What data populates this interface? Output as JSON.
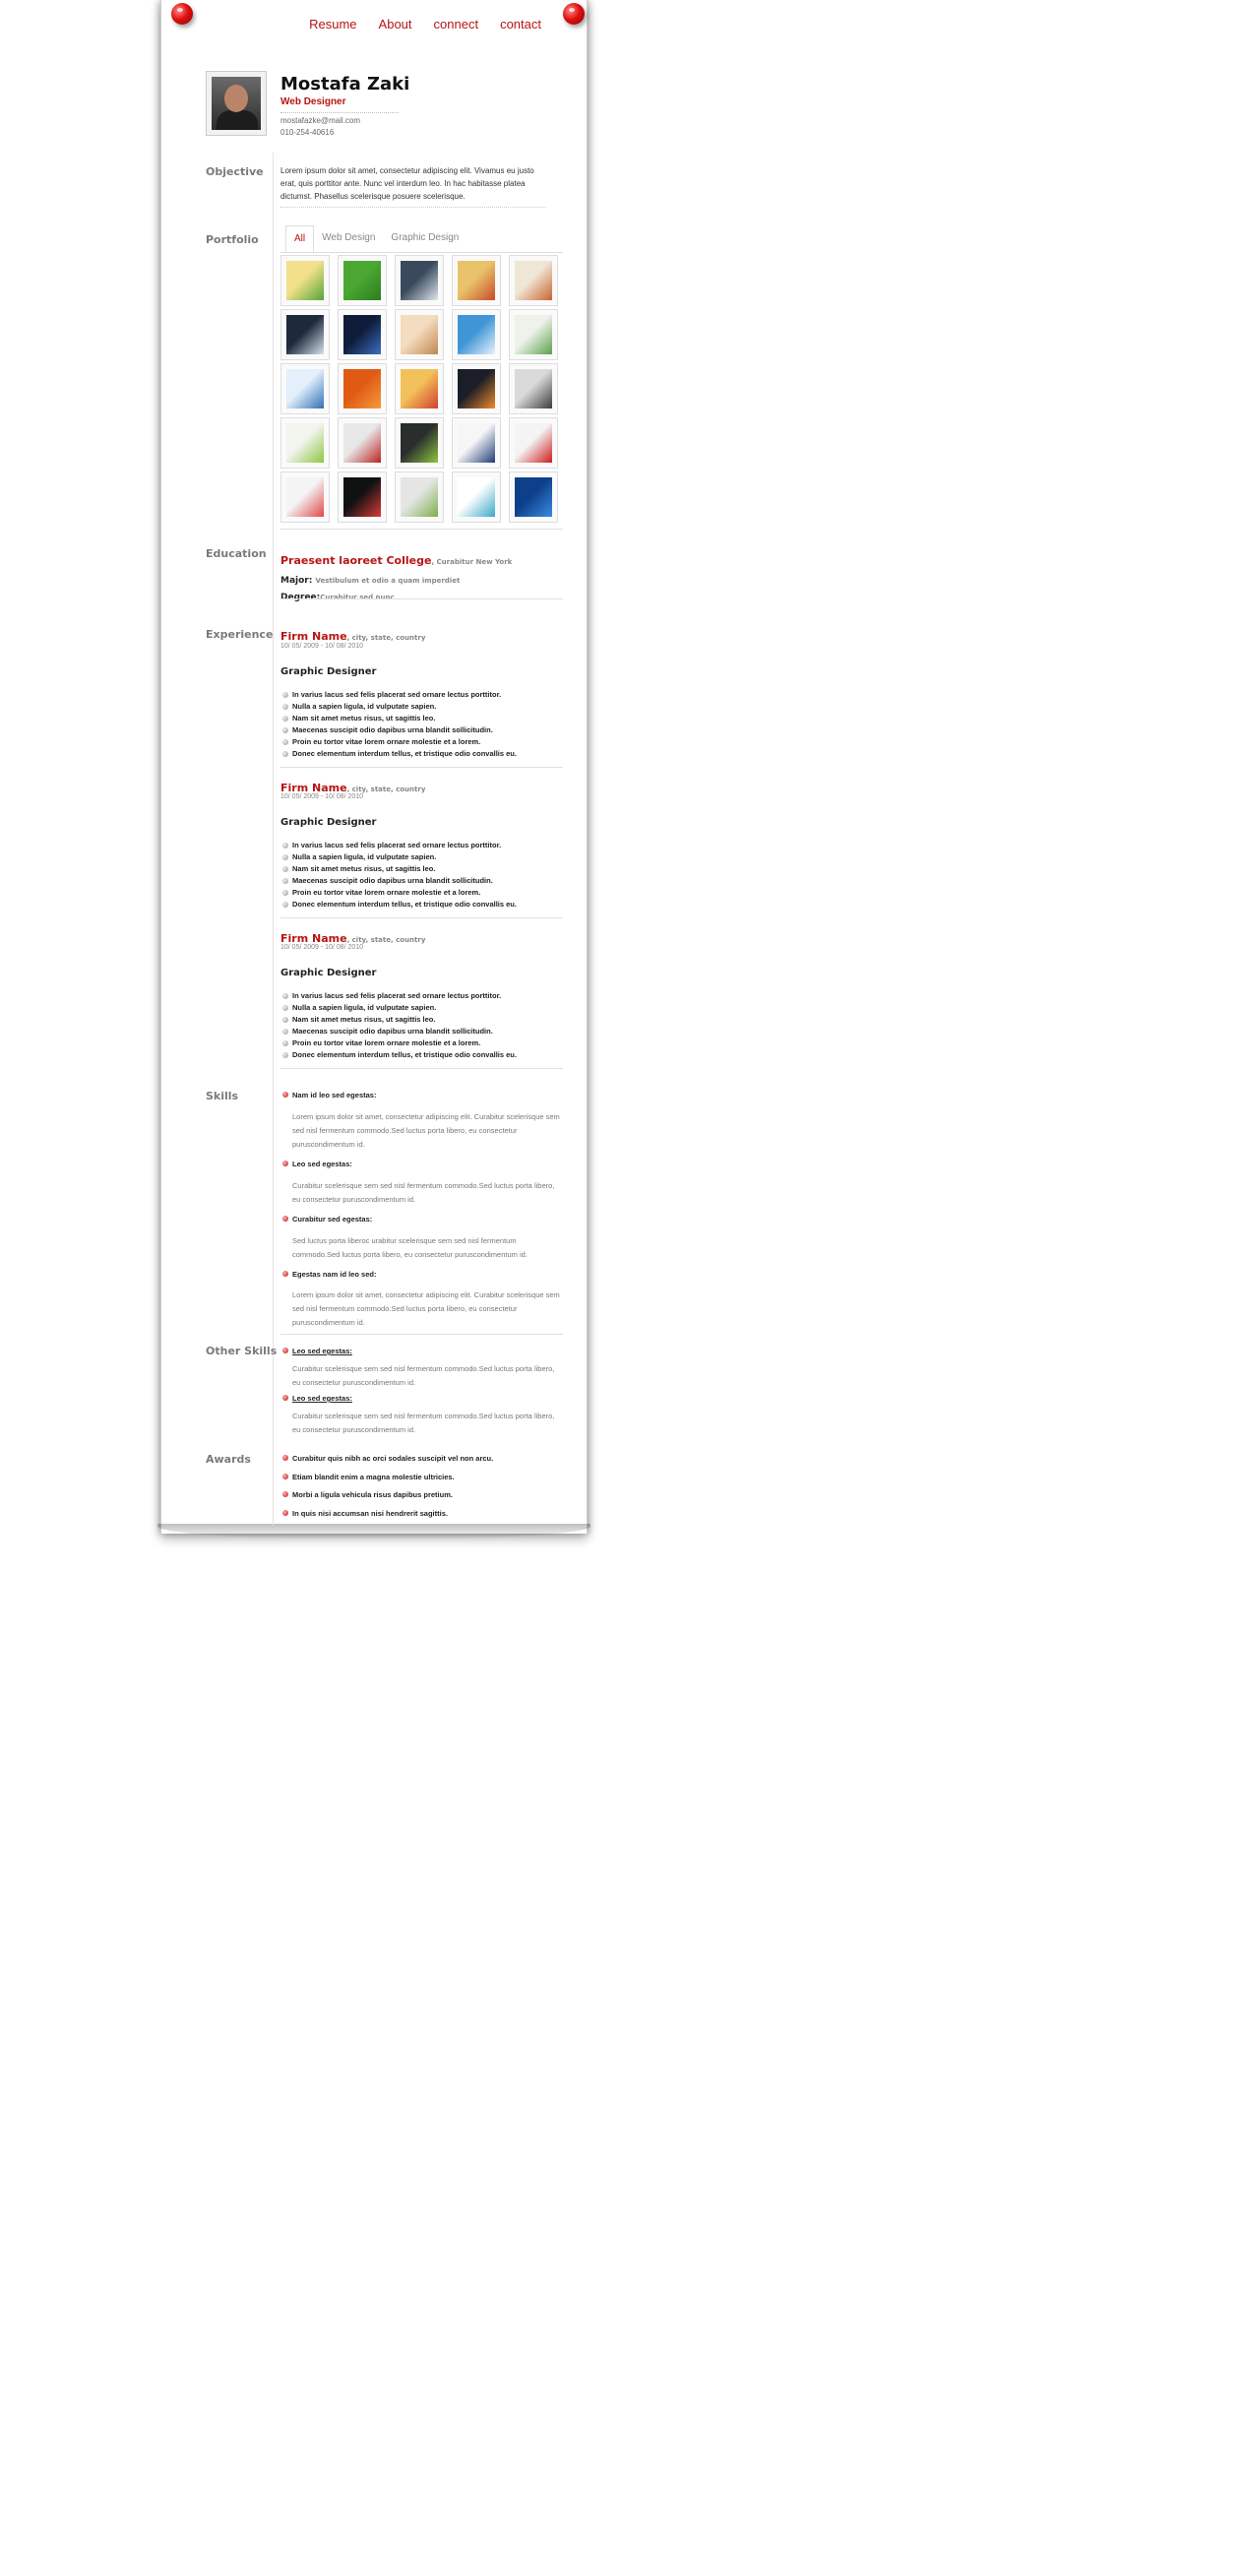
{
  "nav": [
    "Resume",
    "About",
    "connect",
    "contact"
  ],
  "header": {
    "name": "Mostafa Zaki",
    "role": "Web Designer",
    "email": "mostafazke@mail.com",
    "phone": "010-254-40616"
  },
  "sections": {
    "objective": "Objective",
    "portfolio": "Portfolio",
    "education": "Education",
    "experience": "Experience",
    "skills": "Skills",
    "other_skills": "Other Skills",
    "awards": "Awards"
  },
  "objective_text": "Lorem ipsum dolor sit amet, consectetur adipiscing elit. Vivamus eu justo erat, quis porttitor ante. Nunc vel interdum leo. In hac habitasse platea dictumst. Phasellus scelerisque posuere scelerisque.",
  "portfolio": {
    "tabs": [
      "All",
      "Web Design",
      "Graphic Design"
    ],
    "active_tab": "All",
    "thumb_colors": [
      [
        "#f3e08a",
        "#52a53a"
      ],
      [
        "#4aa832",
        "#2e7d1e"
      ],
      [
        "#3a4a5c",
        "#dfe6ee"
      ],
      [
        "#e8c36a",
        "#c94a2a"
      ],
      [
        "#f0e6d6",
        "#c7652e"
      ],
      [
        "#1d2a3a",
        "#d9e3ee"
      ],
      [
        "#0e1c3a",
        "#3c6fc0"
      ],
      [
        "#f4dcc0",
        "#c2874e"
      ],
      [
        "#3f95d6",
        "#e8f3fb"
      ],
      [
        "#eef2ea",
        "#5aa04a"
      ],
      [
        "#e3f0fb",
        "#2f6fb5"
      ],
      [
        "#e05a14",
        "#f59a3a"
      ],
      [
        "#f3c15a",
        "#d0402a"
      ],
      [
        "#1b1e28",
        "#f08a2a"
      ],
      [
        "#dadada",
        "#3a3a3a"
      ],
      [
        "#f2f4ef",
        "#8cc63f"
      ],
      [
        "#e8e8e8",
        "#bb2222"
      ],
      [
        "#2a2d2e",
        "#8cc63f"
      ],
      [
        "#f6f6f6",
        "#1e3c78"
      ],
      [
        "#f4f4f4",
        "#cc1d1d"
      ],
      [
        "#f4f4f4",
        "#e24848"
      ],
      [
        "#111111",
        "#d83a3a"
      ],
      [
        "#e5e5e5",
        "#7bb04a"
      ],
      [
        "#ffffff",
        "#3aa8c8"
      ],
      [
        "#0d3f8a",
        "#3a8ce0"
      ]
    ]
  },
  "education": {
    "college": "Praesent laoreet College",
    "college_loc": ", Curabitur New York",
    "major_label": "Major: ",
    "major_val": "Vestibulum et odio a quam imperdiet",
    "degree_label": "Degree:",
    "degree_val": "Curabitur sed nunc"
  },
  "experience": [
    {
      "firm": "Firm Name",
      "loc": ", city, state, country",
      "dates": "10/ 05/ 2009 - 10/ 08/ 2010",
      "title": "Graphic Designer",
      "bullets": [
        "In varius lacus sed felis placerat sed ornare lectus porttitor.",
        "Nulla a sapien ligula, id vulputate sapien.",
        "Nam sit amet metus risus, ut sagittis leo.",
        "Maecenas suscipit odio dapibus urna blandit sollicitudin.",
        "Proin eu tortor vitae lorem ornare molestie et a lorem.",
        "Donec elementum interdum tellus, et tristique odio convallis eu."
      ]
    },
    {
      "firm": "Firm Name",
      "loc": ", city, state, country",
      "dates": "10/ 05/ 2009 - 10/ 08/ 2010",
      "title": "Graphic Designer",
      "bullets": [
        "In varius lacus sed felis placerat sed ornare lectus porttitor.",
        "Nulla a sapien ligula, id vulputate sapien.",
        "Nam sit amet metus risus, ut sagittis leo.",
        "Maecenas suscipit odio dapibus urna blandit sollicitudin.",
        "Proin eu tortor vitae lorem ornare molestie et a lorem.",
        "Donec elementum interdum tellus, et tristique odio convallis eu."
      ]
    },
    {
      "firm": "Firm Name",
      "loc": ", city, state, country",
      "dates": "10/ 05/ 2009 - 10/ 08/ 2010",
      "title": "Graphic Designer",
      "bullets": [
        "In varius lacus sed felis placerat sed ornare lectus porttitor.",
        "Nulla a sapien ligula, id vulputate sapien.",
        "Nam sit amet metus risus, ut sagittis leo.",
        "Maecenas suscipit odio dapibus urna blandit sollicitudin.",
        "Proin eu tortor vitae lorem ornare molestie et a lorem.",
        "Donec elementum interdum tellus, et tristique odio convallis eu."
      ]
    }
  ],
  "skills": [
    {
      "head": "Nam id leo sed egestas:",
      "text": "Lorem ipsum dolor sit amet, consectetur adipiscing elit. Curabitur scelerisque sem sed nisl fermentum commodo.Sed luctus porta libero, eu consectetur puruscondimentum id."
    },
    {
      "head": "Leo sed egestas:",
      "text": "Curabitur scelerisque sem sed nisl fermentum commodo.Sed luctus porta libero, eu consectetur puruscondimentum id."
    },
    {
      "head": "Curabitur sed egestas:",
      "text": "Sed luctus porta liberoc urabitur scelerisque sem sed nisl fermentum commodo.Sed luctus porta libero, eu consectetur puruscondimentum id."
    },
    {
      "head": "Egestas nam id leo sed:",
      "text": "Lorem ipsum dolor sit amet, consectetur adipiscing elit. Curabitur scelerisque sem sed nisl fermentum commodo.Sed luctus porta libero, eu consectetur puruscondimentum id."
    }
  ],
  "other_skills": [
    {
      "head": "Leo sed egestas:",
      "text": "Curabitur scelerisque sem sed nisl fermentum commodo.Sed luctus porta libero, eu consectetur puruscondimentum id."
    },
    {
      "head": "Leo sed egestas:",
      "text": "Curabitur scelerisque sem sed nisl fermentum commodo.Sed luctus porta libero, eu consectetur puruscondimentum id."
    }
  ],
  "awards": [
    "Curabitur quis nibh ac orci sodales suscipit vel non arcu.",
    "Etiam blandit enim a magna molestie ultricies.",
    "Morbi a ligula vehicula risus dapibus pretium.",
    "In quis nisi accumsan nisi hendrerit sagittis."
  ],
  "colors": {
    "accent": "#b81414",
    "label_grey": "#7a7a7a"
  }
}
